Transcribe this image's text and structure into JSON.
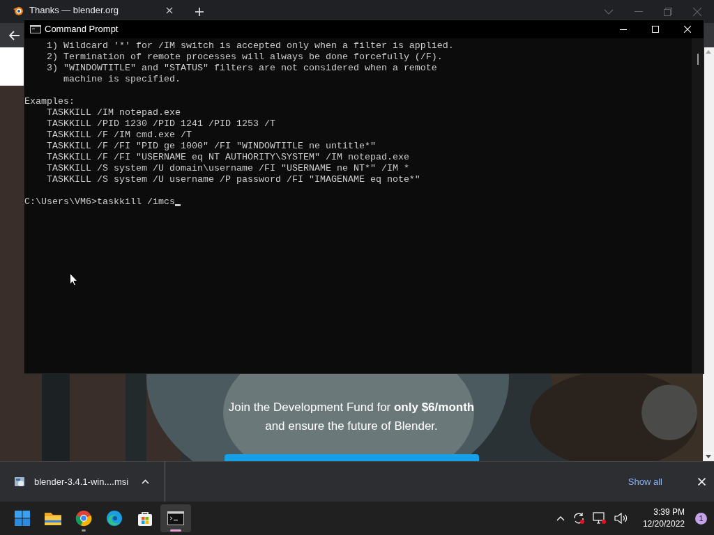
{
  "browser": {
    "tab": {
      "title": "Thanks — blender.org"
    },
    "page": {
      "lines": [
        "Join the Development Fund for **only $6/month**",
        "and ensure the future of Blender."
      ]
    },
    "download": {
      "file": "blender-3.4.1-win....msi",
      "show_all": "Show all"
    }
  },
  "console": {
    "title": "Command Prompt",
    "blocks": [
      [
        "    1) Wildcard '*' for /IM switch is accepted only when a filter is applied.",
        "    2) Termination of remote processes will always be done forcefully (/F).",
        "    3) \"WINDOWTITLE\" and \"STATUS\" filters are not considered when a remote",
        "       machine is specified."
      ],
      [
        "Examples:",
        "    TASKKILL /IM notepad.exe",
        "    TASKKILL /PID 1230 /PID 1241 /PID 1253 /T",
        "    TASKKILL /F /IM cmd.exe /T",
        "    TASKKILL /F /FI \"PID ge 1000\" /FI \"WINDOWTITLE ne untitle*\"",
        "    TASKKILL /F /FI \"USERNAME eq NT AUTHORITY\\SYSTEM\" /IM notepad.exe",
        "    TASKKILL /S system /U domain\\username /FI \"USERNAME ne NT*\" /IM *",
        "    TASKKILL /S system /U username /P password /FI \"IMAGENAME eq note*\""
      ],
      [
        "C:\\Users\\VM6>taskkill /imcs"
      ]
    ]
  },
  "taskbar": {
    "apps": [
      {
        "kind": "start",
        "running": false,
        "selected": false
      },
      {
        "kind": "folder",
        "running": false,
        "selected": false
      },
      {
        "kind": "chrome",
        "running": true,
        "selected": false
      },
      {
        "kind": "edge",
        "running": false,
        "selected": false
      },
      {
        "kind": "store",
        "running": false,
        "selected": false
      },
      {
        "kind": "terminal",
        "running": true,
        "selected": true
      }
    ],
    "time": "3:39 PM",
    "date": "12/20/2022",
    "notifications": "1"
  }
}
